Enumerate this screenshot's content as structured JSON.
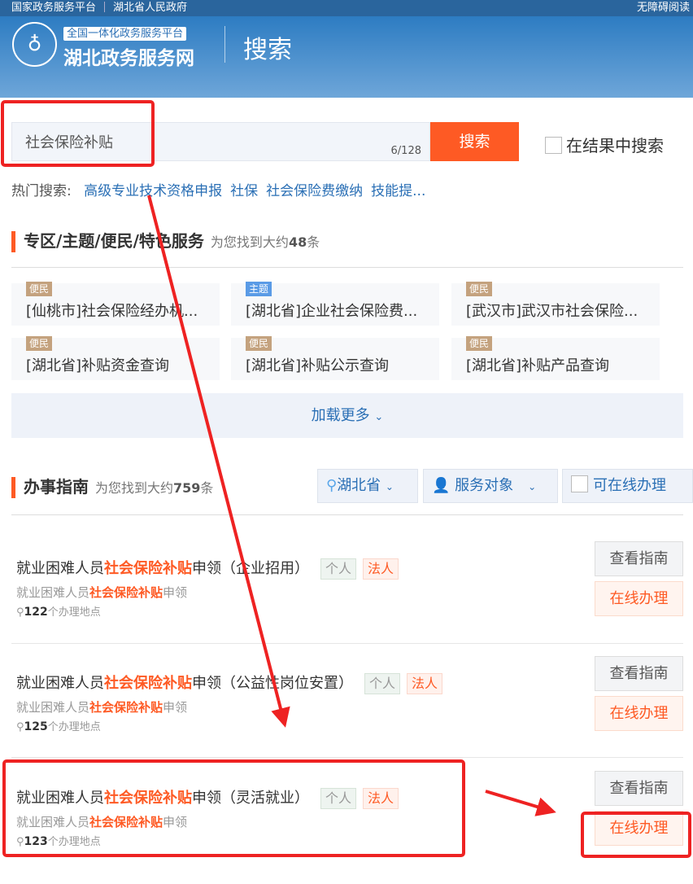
{
  "topbar": {
    "left1": "国家政务服务平台",
    "left2": "湖北省人民政府",
    "right": "无障碍阅读"
  },
  "header": {
    "subtitle": "全国一体化政务服务平台",
    "site": "湖北政务服务网",
    "page_title": "搜索"
  },
  "search": {
    "value": "社会保险补贴",
    "count": "6/128",
    "button": "搜索",
    "in_results": "在结果中搜索"
  },
  "hot": {
    "label": "热门搜索:",
    "items": [
      "高级专业技术资格申报",
      "社保",
      "社会保险费缴纳",
      "技能提..."
    ]
  },
  "zone": {
    "title": "专区/主题/便民/特色服务",
    "found_prefix": "为您找到大约",
    "count": "48",
    "found_suffix": "条",
    "cards": [
      {
        "tag": "便民",
        "title": "[仙桃市]社会保险经办机..."
      },
      {
        "tag": "主题",
        "title": "[湖北省]企业社会保险费..."
      },
      {
        "tag": "便民",
        "title": "[武汉市]武汉市社会保险..."
      },
      {
        "tag": "便民",
        "title": "[湖北省]补贴资金查询"
      },
      {
        "tag": "便民",
        "title": "[湖北省]补贴公示查询"
      },
      {
        "tag": "便民",
        "title": "[湖北省]补贴产品查询"
      }
    ],
    "load_more": "加载更多"
  },
  "guide": {
    "title": "办事指南",
    "found_prefix": "为您找到大约",
    "count": "759",
    "found_suffix": "条",
    "filters": {
      "region": "湖北省",
      "target": "服务对象",
      "online": "可在线办理"
    },
    "items": [
      {
        "pre": "就业困难人员",
        "hl": "社会保险补贴",
        "post": "申领（企业招用）",
        "sub_pre": "就业困难人员",
        "sub_hl": "社会保险补贴",
        "sub_post": "申领",
        "loc_count": "122",
        "loc_text": "个办理地点"
      },
      {
        "pre": "就业困难人员",
        "hl": "社会保险补贴",
        "post": "申领（公益性岗位安置）",
        "sub_pre": "就业困难人员",
        "sub_hl": "社会保险补贴",
        "sub_post": "申领",
        "loc_count": "125",
        "loc_text": "个办理地点"
      },
      {
        "pre": "就业困难人员",
        "hl": "社会保险补贴",
        "post": "申领（灵活就业）",
        "sub_pre": "就业困难人员",
        "sub_hl": "社会保险补贴",
        "sub_post": "申领",
        "loc_count": "123",
        "loc_text": "个办理地点"
      }
    ],
    "badge_personal": "个人",
    "badge_legal": "法人",
    "view_guide": "查看指南",
    "apply_online": "在线办理"
  },
  "colors": {
    "accent": "#fe5a24",
    "link": "#2a6fb5",
    "annotation": "#ee2222"
  }
}
